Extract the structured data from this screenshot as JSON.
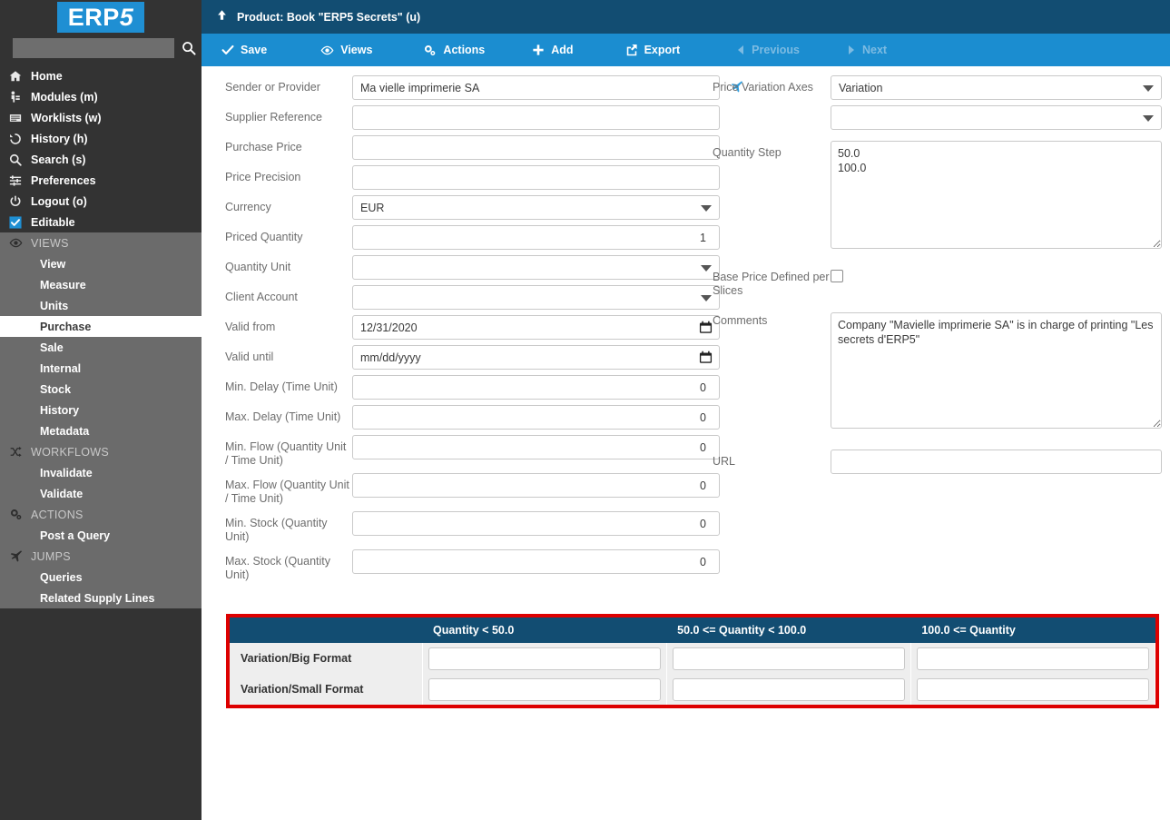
{
  "brand": {
    "logo_prefix": "ERP",
    "logo_suffix": "5",
    "accent": "#1f8fd3"
  },
  "sidebar": {
    "search_placeholder": "",
    "search_value": "",
    "top_items": [
      {
        "label": "Home",
        "icon": "home-icon"
      },
      {
        "label": "Modules (m)",
        "icon": "modules-icon"
      },
      {
        "label": "Worklists (w)",
        "icon": "worklists-icon"
      },
      {
        "label": "History (h)",
        "icon": "history-icon"
      },
      {
        "label": "Search (s)",
        "icon": "search-icon"
      },
      {
        "label": "Preferences",
        "icon": "sliders-icon"
      },
      {
        "label": "Logout (o)",
        "icon": "power-icon"
      },
      {
        "label": "Editable",
        "icon": "checkbox-checked-icon"
      }
    ],
    "groups": [
      {
        "head": "VIEWS",
        "icon": "eye-icon",
        "items": [
          {
            "label": "View",
            "selected": false
          },
          {
            "label": "Measure",
            "selected": false
          },
          {
            "label": "Units",
            "selected": false
          },
          {
            "label": "Purchase",
            "selected": true
          },
          {
            "label": "Sale",
            "selected": false
          },
          {
            "label": "Internal",
            "selected": false
          },
          {
            "label": "Stock",
            "selected": false
          },
          {
            "label": "History",
            "selected": false
          },
          {
            "label": "Metadata",
            "selected": false
          }
        ]
      },
      {
        "head": "WORKFLOWS",
        "icon": "shuffle-icon",
        "items": [
          {
            "label": "Invalidate",
            "selected": false
          },
          {
            "label": "Validate",
            "selected": false
          }
        ]
      },
      {
        "head": "ACTIONS",
        "icon": "gears-icon",
        "items": [
          {
            "label": "Post a Query",
            "selected": false
          }
        ]
      },
      {
        "head": "JUMPS",
        "icon": "plane-icon",
        "items": [
          {
            "label": "Queries",
            "selected": false
          },
          {
            "label": "Related Supply Lines",
            "selected": false
          }
        ]
      }
    ]
  },
  "header": {
    "title": "Product: Book \"ERP5 Secrets\" (u)",
    "title_icon": "arrow-up-icon",
    "bg": "#124d72"
  },
  "toolbar": {
    "bg": "#1b8dd0",
    "buttons": [
      {
        "label": "Save",
        "icon": "check-icon",
        "disabled": false
      },
      {
        "label": "Views",
        "icon": "eye-icon",
        "disabled": false
      },
      {
        "label": "Actions",
        "icon": "gears-icon",
        "disabled": false
      },
      {
        "label": "Add",
        "icon": "plus-icon",
        "disabled": false
      },
      {
        "label": "Export",
        "icon": "export-icon",
        "disabled": false
      },
      {
        "label": "Previous",
        "icon": "caret-left-icon",
        "disabled": true
      },
      {
        "label": "Next",
        "icon": "caret-right-icon",
        "disabled": true
      }
    ]
  },
  "form": {
    "left": {
      "sender_or_provider": {
        "label": "Sender or Provider",
        "value": "Ma vielle imprimerie SA",
        "jump_icon": "plane-icon"
      },
      "supplier_reference": {
        "label": "Supplier Reference",
        "value": ""
      },
      "purchase_price": {
        "label": "Purchase Price",
        "value": ""
      },
      "price_precision": {
        "label": "Price Precision",
        "value": ""
      },
      "currency": {
        "label": "Currency",
        "value": "EUR"
      },
      "priced_quantity": {
        "label": "Priced Quantity",
        "value": "1"
      },
      "quantity_unit": {
        "label": "Quantity Unit",
        "value": ""
      },
      "client_account": {
        "label": "Client Account",
        "value": ""
      },
      "valid_from": {
        "label": "Valid from",
        "value": "12/31/2020",
        "placeholder": "mm/dd/yyyy"
      },
      "valid_until": {
        "label": "Valid until",
        "value": "",
        "placeholder": "mm/dd/yyyy"
      },
      "min_delay": {
        "label": "Min. Delay (Time Unit)",
        "value": "0"
      },
      "max_delay": {
        "label": "Max. Delay (Time Unit)",
        "value": "0"
      },
      "min_flow": {
        "label": "Min. Flow (Quantity Unit / Time Unit)",
        "value": "0"
      },
      "max_flow": {
        "label": "Max. Flow (Quantity Unit / Time Unit)",
        "value": "0"
      },
      "min_stock": {
        "label": "Min. Stock (Quantity Unit)",
        "value": "0"
      },
      "max_stock": {
        "label": "Max. Stock (Quantity Unit)",
        "value": "0"
      }
    },
    "right": {
      "price_variation_axes": {
        "label": "Price Variation Axes",
        "value_1": "Variation",
        "value_2": ""
      },
      "quantity_step": {
        "label": "Quantity Step",
        "value": "50.0\n100.0"
      },
      "base_price_per_slices": {
        "label": "Base Price Defined per Slices",
        "checked": false
      },
      "comments": {
        "label": "Comments",
        "value": "Company \"Mavielle imprimerie SA\" is in charge of printing \"Les secrets d'ERP5\""
      },
      "url": {
        "label": "URL",
        "value": ""
      }
    }
  },
  "variation_table": {
    "border_color": "#dd0000",
    "header_bg": "#124d72",
    "corner_label": "",
    "columns": [
      "Quantity < 50.0",
      "50.0 <= Quantity < 100.0",
      "100.0 <= Quantity"
    ],
    "rows": [
      {
        "label": "Variation/Big Format",
        "cells": [
          "",
          "",
          ""
        ]
      },
      {
        "label": "Variation/Small Format",
        "cells": [
          "",
          "",
          ""
        ]
      }
    ]
  }
}
